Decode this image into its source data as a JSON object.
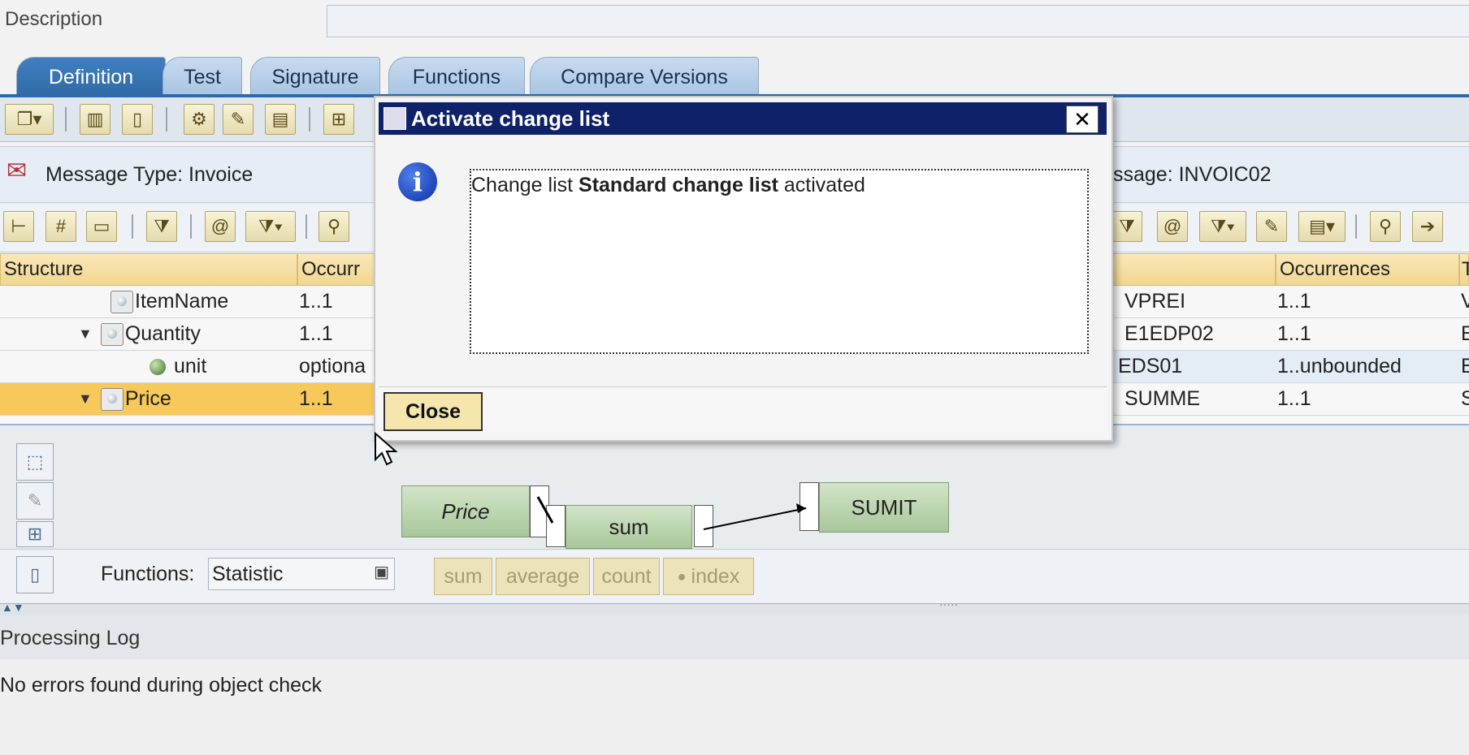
{
  "description": {
    "label": "Description",
    "value": ""
  },
  "tabs": [
    {
      "label": "Definition",
      "active": true
    },
    {
      "label": "Test"
    },
    {
      "label": "Signature"
    },
    {
      "label": "Functions"
    },
    {
      "label": "Compare Versions"
    }
  ],
  "source_header": {
    "text": "Message Type: Invoice"
  },
  "target_header": {
    "text": "ssage: INVOIC02"
  },
  "source_table": {
    "columns": [
      "Structure",
      "Occurr"
    ],
    "rows": [
      {
        "name": "ItemName",
        "occurrence": "1..1"
      },
      {
        "name": "Quantity",
        "occurrence": "1..1",
        "expanded": true
      },
      {
        "name": "unit",
        "occurrence": "optiona"
      },
      {
        "name": "Price",
        "occurrence": "1..1",
        "expanded": true,
        "selected": true
      }
    ]
  },
  "target_table": {
    "columns": [
      "Occurrences",
      "T"
    ],
    "rows": [
      {
        "name": "VPREI",
        "occurrence": "1..1",
        "type": "V"
      },
      {
        "name": "E1EDP02",
        "occurrence": "1..1",
        "type": "E"
      },
      {
        "name": "EDS01",
        "occurrence": "1..unbounded",
        "type": "E"
      },
      {
        "name": "SUMME",
        "occurrence": "1..1",
        "type": "S"
      }
    ]
  },
  "mapping": {
    "source_box": "Price",
    "function_box": "sum",
    "target_box": "SUMIT"
  },
  "functions_bar": {
    "label": "Functions:",
    "selected": "Statistic",
    "buttons": [
      "sum",
      "average",
      "count",
      "index"
    ]
  },
  "processing_log": {
    "title": "Processing Log",
    "message": "No errors found during object check"
  },
  "dialog": {
    "title": "Activate change list",
    "message_prefix": "Change list",
    "message_bold": "Standard change list",
    "message_suffix": "activated",
    "close_label": "Close",
    "close_x": "✕"
  },
  "colors": {
    "tab_active": "#2f6aa6",
    "dialog_title": "#0f2168",
    "selected_row": "#f7c95a",
    "function_box": "#a8c79a"
  }
}
